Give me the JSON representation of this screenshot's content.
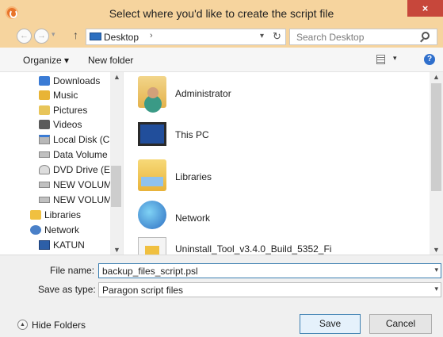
{
  "window": {
    "title": "Select where you'd like to create the script file",
    "close_glyph": "×"
  },
  "nav": {
    "back": "←",
    "forward": "→",
    "recent": "▾",
    "up": "↑"
  },
  "address": {
    "location": "Desktop",
    "separator": "›",
    "dropdown": "▾",
    "refresh": "↻"
  },
  "search": {
    "placeholder": "Search Desktop"
  },
  "toolbar": {
    "organize": "Organize ▾",
    "new_folder": "New folder",
    "view_dropdown": "▾",
    "help": "?"
  },
  "sidebar": {
    "items": [
      {
        "label": "Downloads",
        "icon": "downloads-icon"
      },
      {
        "label": "Music",
        "icon": "music-icon"
      },
      {
        "label": "Pictures",
        "icon": "pictures-icon"
      },
      {
        "label": "Videos",
        "icon": "videos-icon"
      },
      {
        "label": "Local Disk (C:)",
        "icon": "local-disk-icon"
      },
      {
        "label": "Data Volume (D",
        "icon": "drive-icon"
      },
      {
        "label": "DVD Drive (E:)",
        "icon": "dvd-drive-icon"
      },
      {
        "label": "NEW VOLUME",
        "icon": "drive-icon"
      },
      {
        "label": "NEW VOLUME",
        "icon": "drive-icon"
      },
      {
        "label": "Libraries",
        "icon": "libraries-icon"
      },
      {
        "label": "Network",
        "icon": "network-icon"
      },
      {
        "label": "KATUN",
        "icon": "computer-icon"
      }
    ]
  },
  "files": [
    {
      "name": "Administrator",
      "icon": "user-folder-icon"
    },
    {
      "name": "This PC",
      "icon": "this-pc-icon"
    },
    {
      "name": "Libraries",
      "icon": "libraries-icon"
    },
    {
      "name": "Network",
      "icon": "network-icon"
    },
    {
      "name": "Uninstall_Tool_v3.4.0_Build_5352_Fi",
      "icon": "installer-icon"
    }
  ],
  "scroll": {
    "up": "▲",
    "down": "▼"
  },
  "form": {
    "file_name_label": "File name:",
    "file_name_value": "backup_files_script.psl",
    "save_type_label": "Save as type:",
    "save_type_value": "Paragon script files",
    "dropdown": "▾"
  },
  "footer": {
    "hide_folders": "Hide Folders",
    "hide_glyph": "▲",
    "save": "Save",
    "cancel": "Cancel"
  }
}
